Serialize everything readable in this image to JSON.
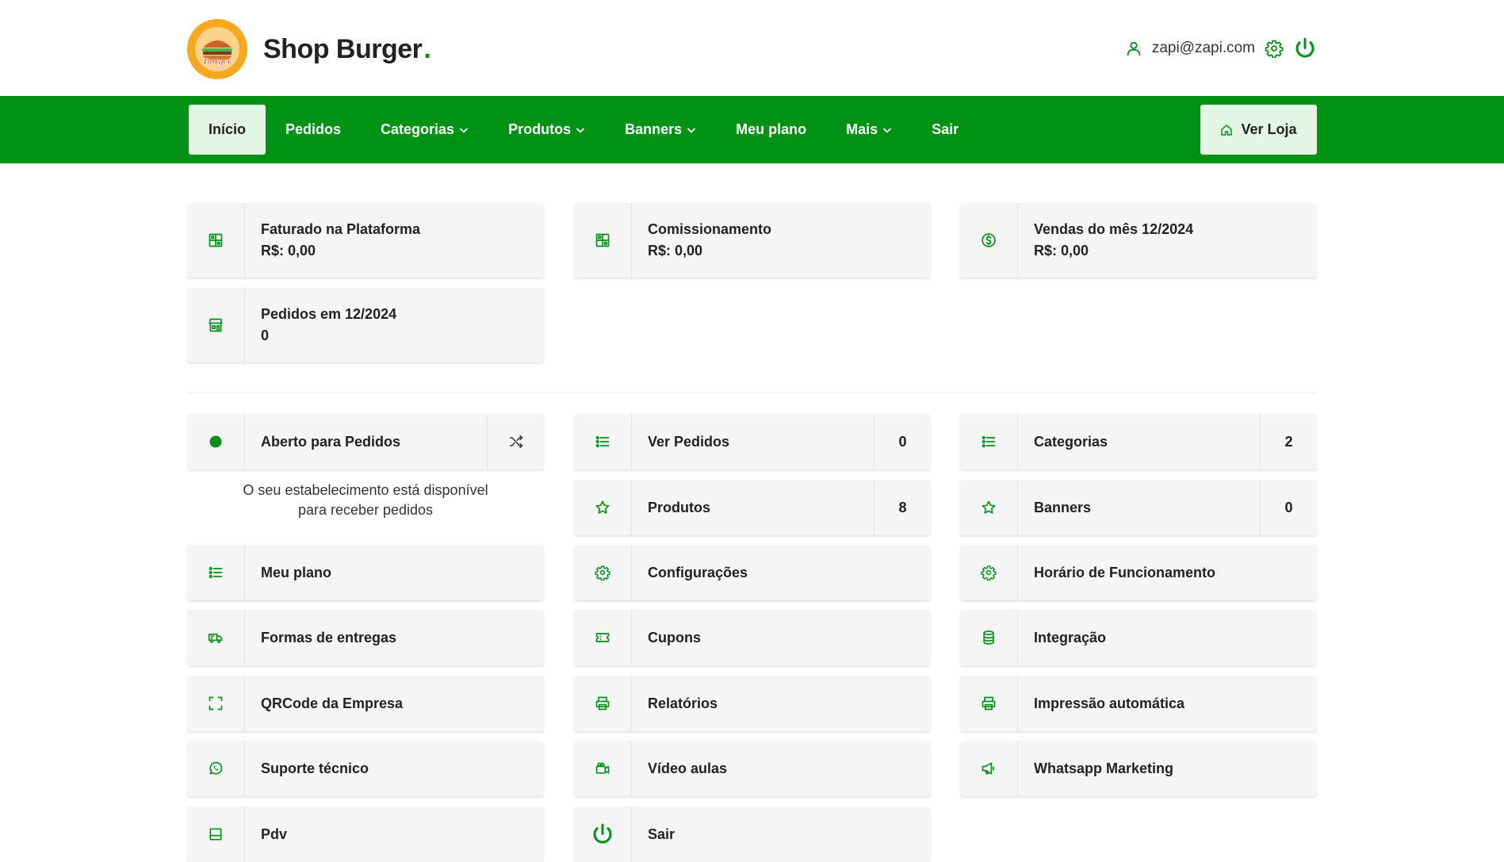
{
  "brand": {
    "name": "Shop Burger",
    "dot": ".",
    "logo_text": "Burger"
  },
  "user": {
    "email": "zapi@zapi.com"
  },
  "nav": {
    "items": [
      {
        "label": "Início",
        "active": true,
        "dropdown": false
      },
      {
        "label": "Pedidos",
        "active": false,
        "dropdown": false
      },
      {
        "label": "Categorias",
        "active": false,
        "dropdown": true
      },
      {
        "label": "Produtos",
        "active": false,
        "dropdown": true
      },
      {
        "label": "Banners",
        "active": false,
        "dropdown": true
      },
      {
        "label": "Meu plano",
        "active": false,
        "dropdown": false
      },
      {
        "label": "Mais",
        "active": false,
        "dropdown": true
      },
      {
        "label": "Sair",
        "active": false,
        "dropdown": false
      }
    ],
    "ver_loja": "Ver Loja"
  },
  "stats": {
    "faturado": {
      "label": "Faturado na Plataforma",
      "value": "R$: 0,00",
      "icon": "grid-icon"
    },
    "comissionamento": {
      "label": "Comissionamento",
      "value": "R$: 0,00",
      "icon": "grid-icon"
    },
    "vendas": {
      "label": "Vendas do mês 12/2024",
      "value": "R$: 0,00",
      "icon": "dollar-circle-icon"
    },
    "pedidos": {
      "label": "Pedidos em 12/2024",
      "value": "0",
      "icon": "store-icon"
    }
  },
  "status": {
    "label": "Aberto para Pedidos",
    "message_line1": "O seu estabelecimento está disponível",
    "message_line2": "para receber pedidos"
  },
  "menu": {
    "ver_pedidos": {
      "label": "Ver Pedidos",
      "count": "0"
    },
    "categorias": {
      "label": "Categorias",
      "count": "2"
    },
    "produtos": {
      "label": "Produtos",
      "count": "8"
    },
    "banners": {
      "label": "Banners",
      "count": "0"
    },
    "meu_plano": {
      "label": "Meu plano"
    },
    "configuracoes": {
      "label": "Configurações"
    },
    "horario": {
      "label": "Horário de Funcionamento"
    },
    "formas_entrega": {
      "label": "Formas de entregas"
    },
    "cupons": {
      "label": "Cupons"
    },
    "integracao": {
      "label": "Integração"
    },
    "qrcode": {
      "label": "QRCode da Empresa"
    },
    "relatorios": {
      "label": "Relatórios"
    },
    "impressao": {
      "label": "Impressão automática"
    },
    "suporte": {
      "label": "Suporte técnico"
    },
    "video_aulas": {
      "label": "Vídeo aulas"
    },
    "whatsapp": {
      "label": "Whatsapp Marketing"
    },
    "pdv": {
      "label": "Pdv"
    },
    "sair": {
      "label": "Sair"
    }
  },
  "colors": {
    "primary": "#009214",
    "active_bg": "#e3f5e3",
    "card_bg": "#f5f5f5",
    "logo_orange": "#f6a823"
  }
}
